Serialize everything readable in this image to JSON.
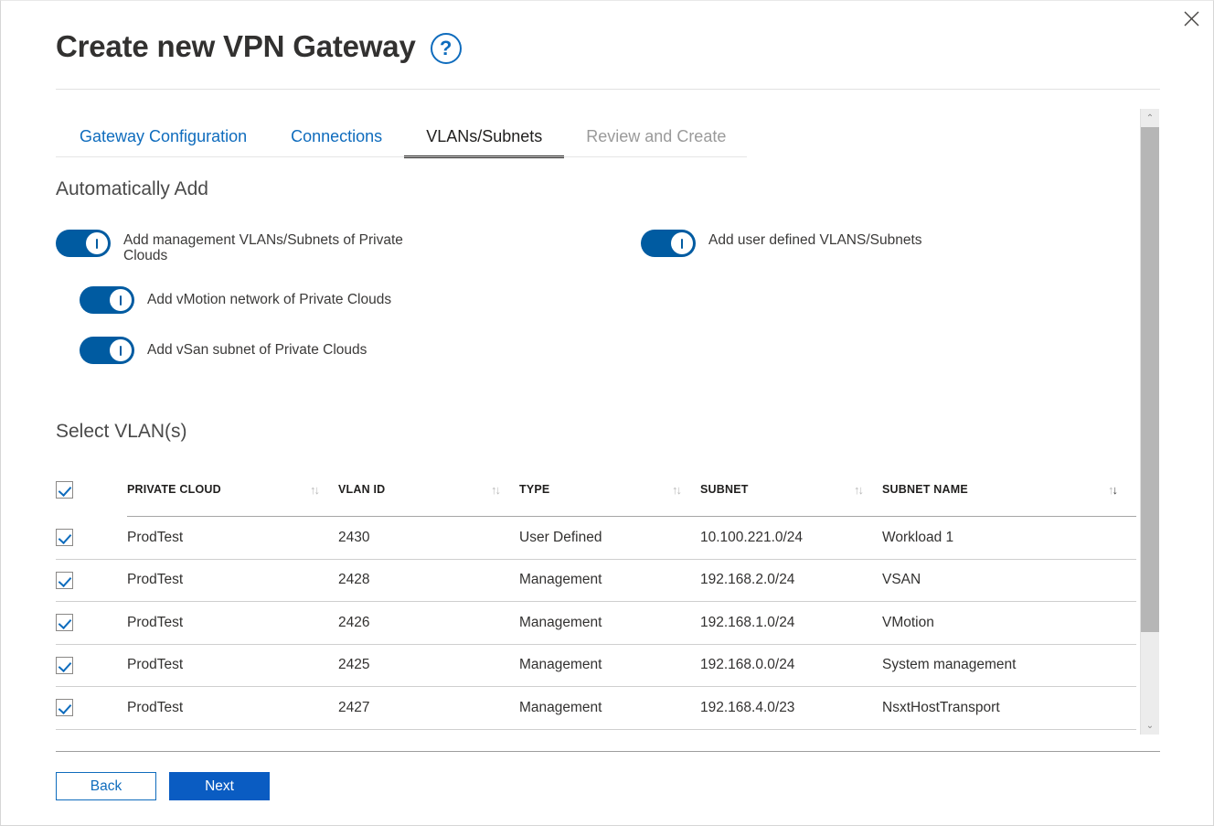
{
  "window": {
    "close_label": "×",
    "close_icon": "close-icon"
  },
  "header": {
    "title": "Create new VPN Gateway",
    "help_icon": "?",
    "help_icon_name": "help-circle-icon"
  },
  "tabs": [
    {
      "label": "Gateway Configuration",
      "state": "link"
    },
    {
      "label": "Connections",
      "state": "link"
    },
    {
      "label": "VLANs/Subnets",
      "state": "active"
    },
    {
      "label": "Review and Create",
      "state": "disabled"
    }
  ],
  "auto_add": {
    "heading": "Automatically Add",
    "toggles": [
      {
        "label": "Add management VLANs/Subnets of Private Clouds",
        "on": true
      },
      {
        "label": "Add user defined VLANS/Subnets",
        "on": true
      },
      {
        "label": "Add vMotion network of Private Clouds",
        "on": true
      },
      {
        "label": "Add vSan subnet of Private Clouds",
        "on": true
      }
    ]
  },
  "select_vlans": {
    "heading": "Select VLAN(s)",
    "select_all_checked": true,
    "columns": [
      {
        "label": "PRIVATE CLOUD",
        "sort": "neutral"
      },
      {
        "label": "VLAN ID",
        "sort": "neutral"
      },
      {
        "label": "TYPE",
        "sort": "neutral"
      },
      {
        "label": "SUBNET",
        "sort": "neutral"
      },
      {
        "label": "SUBNET NAME",
        "sort": "desc"
      }
    ],
    "sort_glyph": "↑↓",
    "rows": [
      {
        "checked": true,
        "private_cloud": "ProdTest",
        "vlan_id": "2430",
        "type": "User Defined",
        "subnet": "10.100.221.0/24",
        "subnet_name": "Workload 1"
      },
      {
        "checked": true,
        "private_cloud": "ProdTest",
        "vlan_id": "2428",
        "type": "Management",
        "subnet": "192.168.2.0/24",
        "subnet_name": "VSAN"
      },
      {
        "checked": true,
        "private_cloud": "ProdTest",
        "vlan_id": "2426",
        "type": "Management",
        "subnet": "192.168.1.0/24",
        "subnet_name": "VMotion"
      },
      {
        "checked": true,
        "private_cloud": "ProdTest",
        "vlan_id": "2425",
        "type": "Management",
        "subnet": "192.168.0.0/24",
        "subnet_name": "System management"
      },
      {
        "checked": true,
        "private_cloud": "ProdTest",
        "vlan_id": "2427",
        "type": "Management",
        "subnet": "192.168.4.0/23",
        "subnet_name": "NsxtHostTransport"
      }
    ]
  },
  "scrollbar": {
    "up_glyph": "⌃",
    "down_glyph": "⌄"
  },
  "footer": {
    "back_label": "Back",
    "next_label": "Next"
  },
  "colors": {
    "accent_blue": "#0f6cbd",
    "primary_button": "#0a5cc2",
    "toggle_on": "#005ba1",
    "text": "#323130",
    "disabled_text": "#9a9a9a"
  }
}
